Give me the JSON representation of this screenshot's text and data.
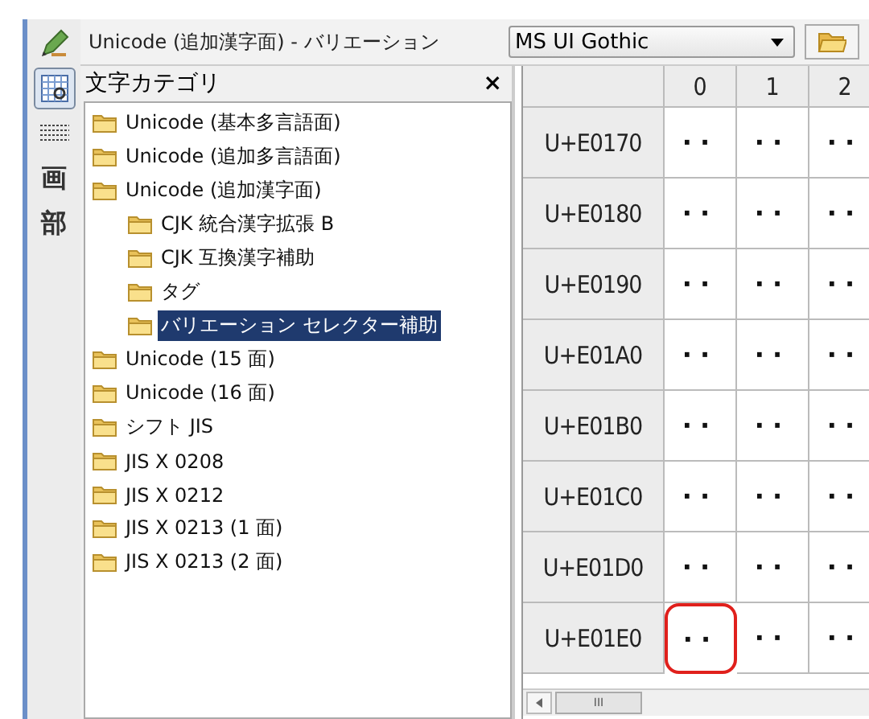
{
  "toolbar": [
    {
      "kind": "pencil",
      "selected": false
    },
    {
      "kind": "grid",
      "selected": true
    },
    {
      "kind": "keyboard",
      "selected": false
    },
    {
      "kind": "text",
      "label": "画",
      "selected": false
    },
    {
      "kind": "text",
      "label": "部",
      "selected": false
    }
  ],
  "title": "Unicode (追加漢字面) - バリエーション",
  "font_select": {
    "value": "MS UI Gothic"
  },
  "panel": {
    "title": "文字カテゴリ",
    "close": "×"
  },
  "tree": [
    {
      "label": "Unicode (基本多言語面)",
      "selected": false
    },
    {
      "label": "Unicode (追加多言語面)",
      "selected": false
    },
    {
      "label": "Unicode (追加漢字面)",
      "selected": false,
      "children": [
        {
          "label": "CJK 統合漢字拡張 B",
          "selected": false
        },
        {
          "label": "CJK 互換漢字補助",
          "selected": false
        },
        {
          "label": "タグ",
          "selected": false
        },
        {
          "label": "バリエーション セレクター補助",
          "selected": true
        }
      ]
    },
    {
      "label": "Unicode (15 面)",
      "selected": false
    },
    {
      "label": "Unicode (16 面)",
      "selected": false
    },
    {
      "label": "シフト JIS",
      "selected": false
    },
    {
      "label": "JIS X 0208",
      "selected": false
    },
    {
      "label": "JIS X 0212",
      "selected": false
    },
    {
      "label": "JIS X 0213 (1 面)",
      "selected": false
    },
    {
      "label": "JIS X 0213 (2 面)",
      "selected": false
    }
  ],
  "grid": {
    "columns": [
      "0",
      "1",
      "2"
    ],
    "rows": [
      {
        "code": "U+E0170",
        "cells": [
          {
            "text": "··",
            "highlighted": false
          },
          {
            "text": "··",
            "highlighted": false
          },
          {
            "text": "··",
            "highlighted": false
          }
        ]
      },
      {
        "code": "U+E0180",
        "cells": [
          {
            "text": "··",
            "highlighted": false
          },
          {
            "text": "··",
            "highlighted": false
          },
          {
            "text": "··",
            "highlighted": false
          }
        ]
      },
      {
        "code": "U+E0190",
        "cells": [
          {
            "text": "··",
            "highlighted": false
          },
          {
            "text": "··",
            "highlighted": false
          },
          {
            "text": "··",
            "highlighted": false
          }
        ]
      },
      {
        "code": "U+E01A0",
        "cells": [
          {
            "text": "··",
            "highlighted": false
          },
          {
            "text": "··",
            "highlighted": false
          },
          {
            "text": "··",
            "highlighted": false
          }
        ]
      },
      {
        "code": "U+E01B0",
        "cells": [
          {
            "text": "··",
            "highlighted": false
          },
          {
            "text": "··",
            "highlighted": false
          },
          {
            "text": "··",
            "highlighted": false
          }
        ]
      },
      {
        "code": "U+E01C0",
        "cells": [
          {
            "text": "··",
            "highlighted": false
          },
          {
            "text": "··",
            "highlighted": false
          },
          {
            "text": "··",
            "highlighted": false
          }
        ]
      },
      {
        "code": "U+E01D0",
        "cells": [
          {
            "text": "··",
            "highlighted": false
          },
          {
            "text": "··",
            "highlighted": false
          },
          {
            "text": "··",
            "highlighted": false
          }
        ]
      },
      {
        "code": "U+E01E0",
        "cells": [
          {
            "text": "··",
            "highlighted": true
          },
          {
            "text": "··",
            "highlighted": false
          },
          {
            "text": "··",
            "highlighted": false
          }
        ]
      }
    ]
  },
  "hscroll": {
    "grip": "III"
  }
}
